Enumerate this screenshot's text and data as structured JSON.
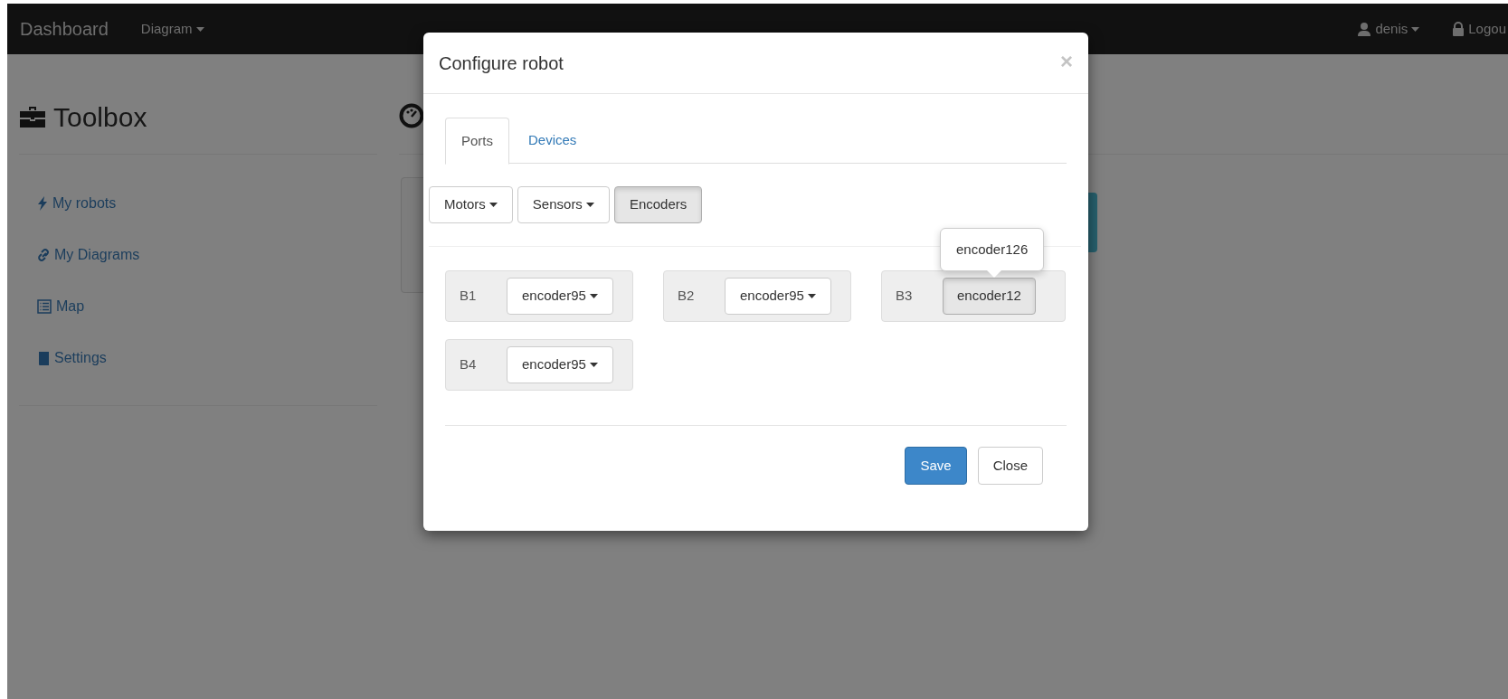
{
  "navbar": {
    "brand": "Dashboard",
    "menu": [
      {
        "label": "Diagram",
        "dropdown": true
      }
    ],
    "right": [
      {
        "label": "denis",
        "dropdown": true
      },
      {
        "label": "Logou",
        "dropdown": false
      }
    ]
  },
  "sidebar": {
    "title": "Toolbox",
    "items": [
      {
        "label": "My robots"
      },
      {
        "label": "My Diagrams"
      },
      {
        "label": "Map"
      },
      {
        "label": "Settings"
      }
    ]
  },
  "modal": {
    "title": "Configure robot",
    "close": "×",
    "tabs": [
      {
        "label": "Ports",
        "selected": true
      },
      {
        "label": "Devices",
        "selected": false
      }
    ],
    "port_groups": [
      {
        "label": "Motors",
        "dropdown": true,
        "selected": false
      },
      {
        "label": "Sensors",
        "dropdown": true,
        "selected": false
      },
      {
        "label": "Encoders",
        "dropdown": false,
        "selected": true
      }
    ],
    "ports": [
      {
        "name": "B1",
        "value": "encoder95",
        "dropdown": true,
        "active": false
      },
      {
        "name": "B2",
        "value": "encoder95",
        "dropdown": true,
        "active": false
      },
      {
        "name": "B3",
        "value": "encoder12",
        "dropdown": false,
        "active": true,
        "tooltip": "encoder126"
      },
      {
        "name": "B4",
        "value": "encoder95",
        "dropdown": true,
        "active": false
      }
    ],
    "buttons": [
      {
        "label": "Save",
        "kind": "primary"
      },
      {
        "label": "Close",
        "kind": "default"
      }
    ]
  }
}
